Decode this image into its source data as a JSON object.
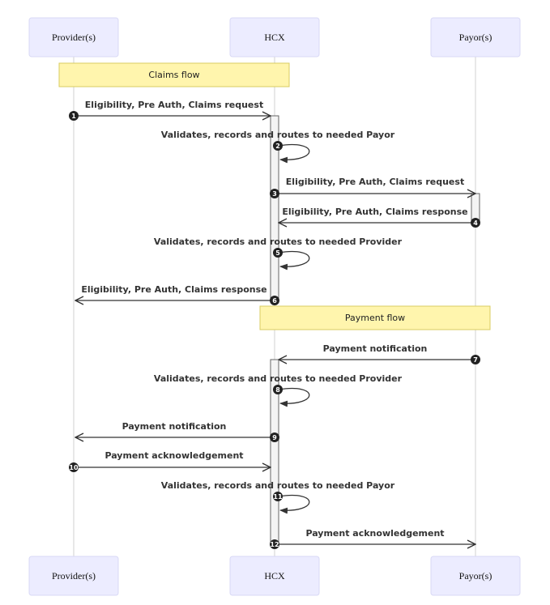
{
  "diagram": {
    "type": "sequence",
    "actors": [
      {
        "id": "provider",
        "label": "Provider(s)"
      },
      {
        "id": "hcx",
        "label": "HCX"
      },
      {
        "id": "payor",
        "label": "Payor(s)"
      }
    ],
    "notes": [
      {
        "label": "Claims flow",
        "over": [
          "provider",
          "hcx"
        ]
      },
      {
        "label": "Payment flow",
        "over": [
          "hcx",
          "payor"
        ]
      }
    ],
    "messages": [
      {
        "seq": "1",
        "from": "provider",
        "to": "hcx",
        "label": "Eligibility, Pre Auth, Claims request"
      },
      {
        "seq": "2",
        "from": "hcx",
        "to": "hcx",
        "label": "Validates, records and routes to needed Payor"
      },
      {
        "seq": "3",
        "from": "hcx",
        "to": "payor",
        "label": "Eligibility, Pre Auth, Claims request"
      },
      {
        "seq": "4",
        "from": "payor",
        "to": "hcx",
        "label": "Eligibility, Pre Auth, Claims response"
      },
      {
        "seq": "5",
        "from": "hcx",
        "to": "hcx",
        "label": "Validates, records and routes to needed Provider"
      },
      {
        "seq": "6",
        "from": "hcx",
        "to": "provider",
        "label": "Eligibility, Pre Auth, Claims response"
      },
      {
        "seq": "7",
        "from": "payor",
        "to": "hcx",
        "label": "Payment notification"
      },
      {
        "seq": "8",
        "from": "hcx",
        "to": "hcx",
        "label": "Validates, records and routes to needed Provider"
      },
      {
        "seq": "9",
        "from": "hcx",
        "to": "provider",
        "label": "Payment notification"
      },
      {
        "seq": "10",
        "from": "provider",
        "to": "hcx",
        "label": "Payment acknowledgement"
      },
      {
        "seq": "11",
        "from": "hcx",
        "to": "hcx",
        "label": "Validates, records and routes to needed Payor"
      },
      {
        "seq": "12",
        "from": "hcx",
        "to": "payor",
        "label": "Payment acknowledgement"
      }
    ]
  }
}
